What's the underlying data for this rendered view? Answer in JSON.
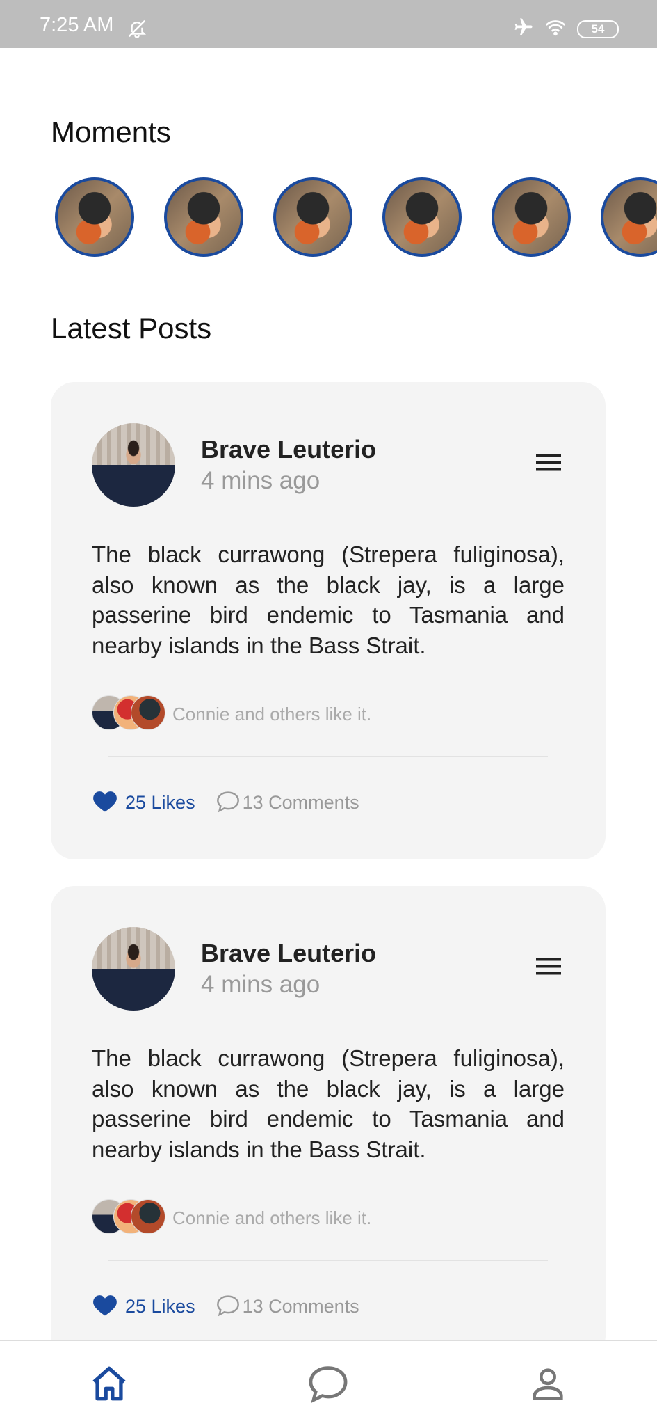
{
  "status_bar": {
    "time": "7:25 AM",
    "battery": "54"
  },
  "moments": {
    "title": "Moments",
    "count": 6
  },
  "latest_posts": {
    "title": "Latest Posts"
  },
  "posts": [
    {
      "author": "Brave Leuterio",
      "time": "4 mins ago",
      "text": "The black currawong (Strepera fuliginosa), also known as the black jay, is a large passerine bird endemic to Tasmania and nearby islands in the Bass Strait.",
      "likes_summary": "Connie and others like it.",
      "likes_label": "25 Likes",
      "comments_label": "13 Comments"
    },
    {
      "author": "Brave Leuterio",
      "time": "4 mins ago",
      "text": "The black currawong (Strepera fuliginosa), also known as the black jay, is a large passerine bird endemic to Tasmania and nearby islands in the Bass Strait.",
      "likes_summary": "Connie and others like it.",
      "likes_label": "25 Likes",
      "comments_label": "13 Comments"
    }
  ],
  "colors": {
    "accent": "#1a4a9e",
    "card_bg": "#f4f4f4",
    "status_bar": "#bdbdbd"
  },
  "icons": {
    "status": [
      "mute-bell-icon",
      "airplane-icon",
      "wifi-icon",
      "battery-icon"
    ],
    "post": [
      "menu-icon",
      "heart-icon",
      "comment-icon"
    ],
    "nav": [
      "home-icon",
      "chat-icon",
      "profile-icon"
    ]
  }
}
